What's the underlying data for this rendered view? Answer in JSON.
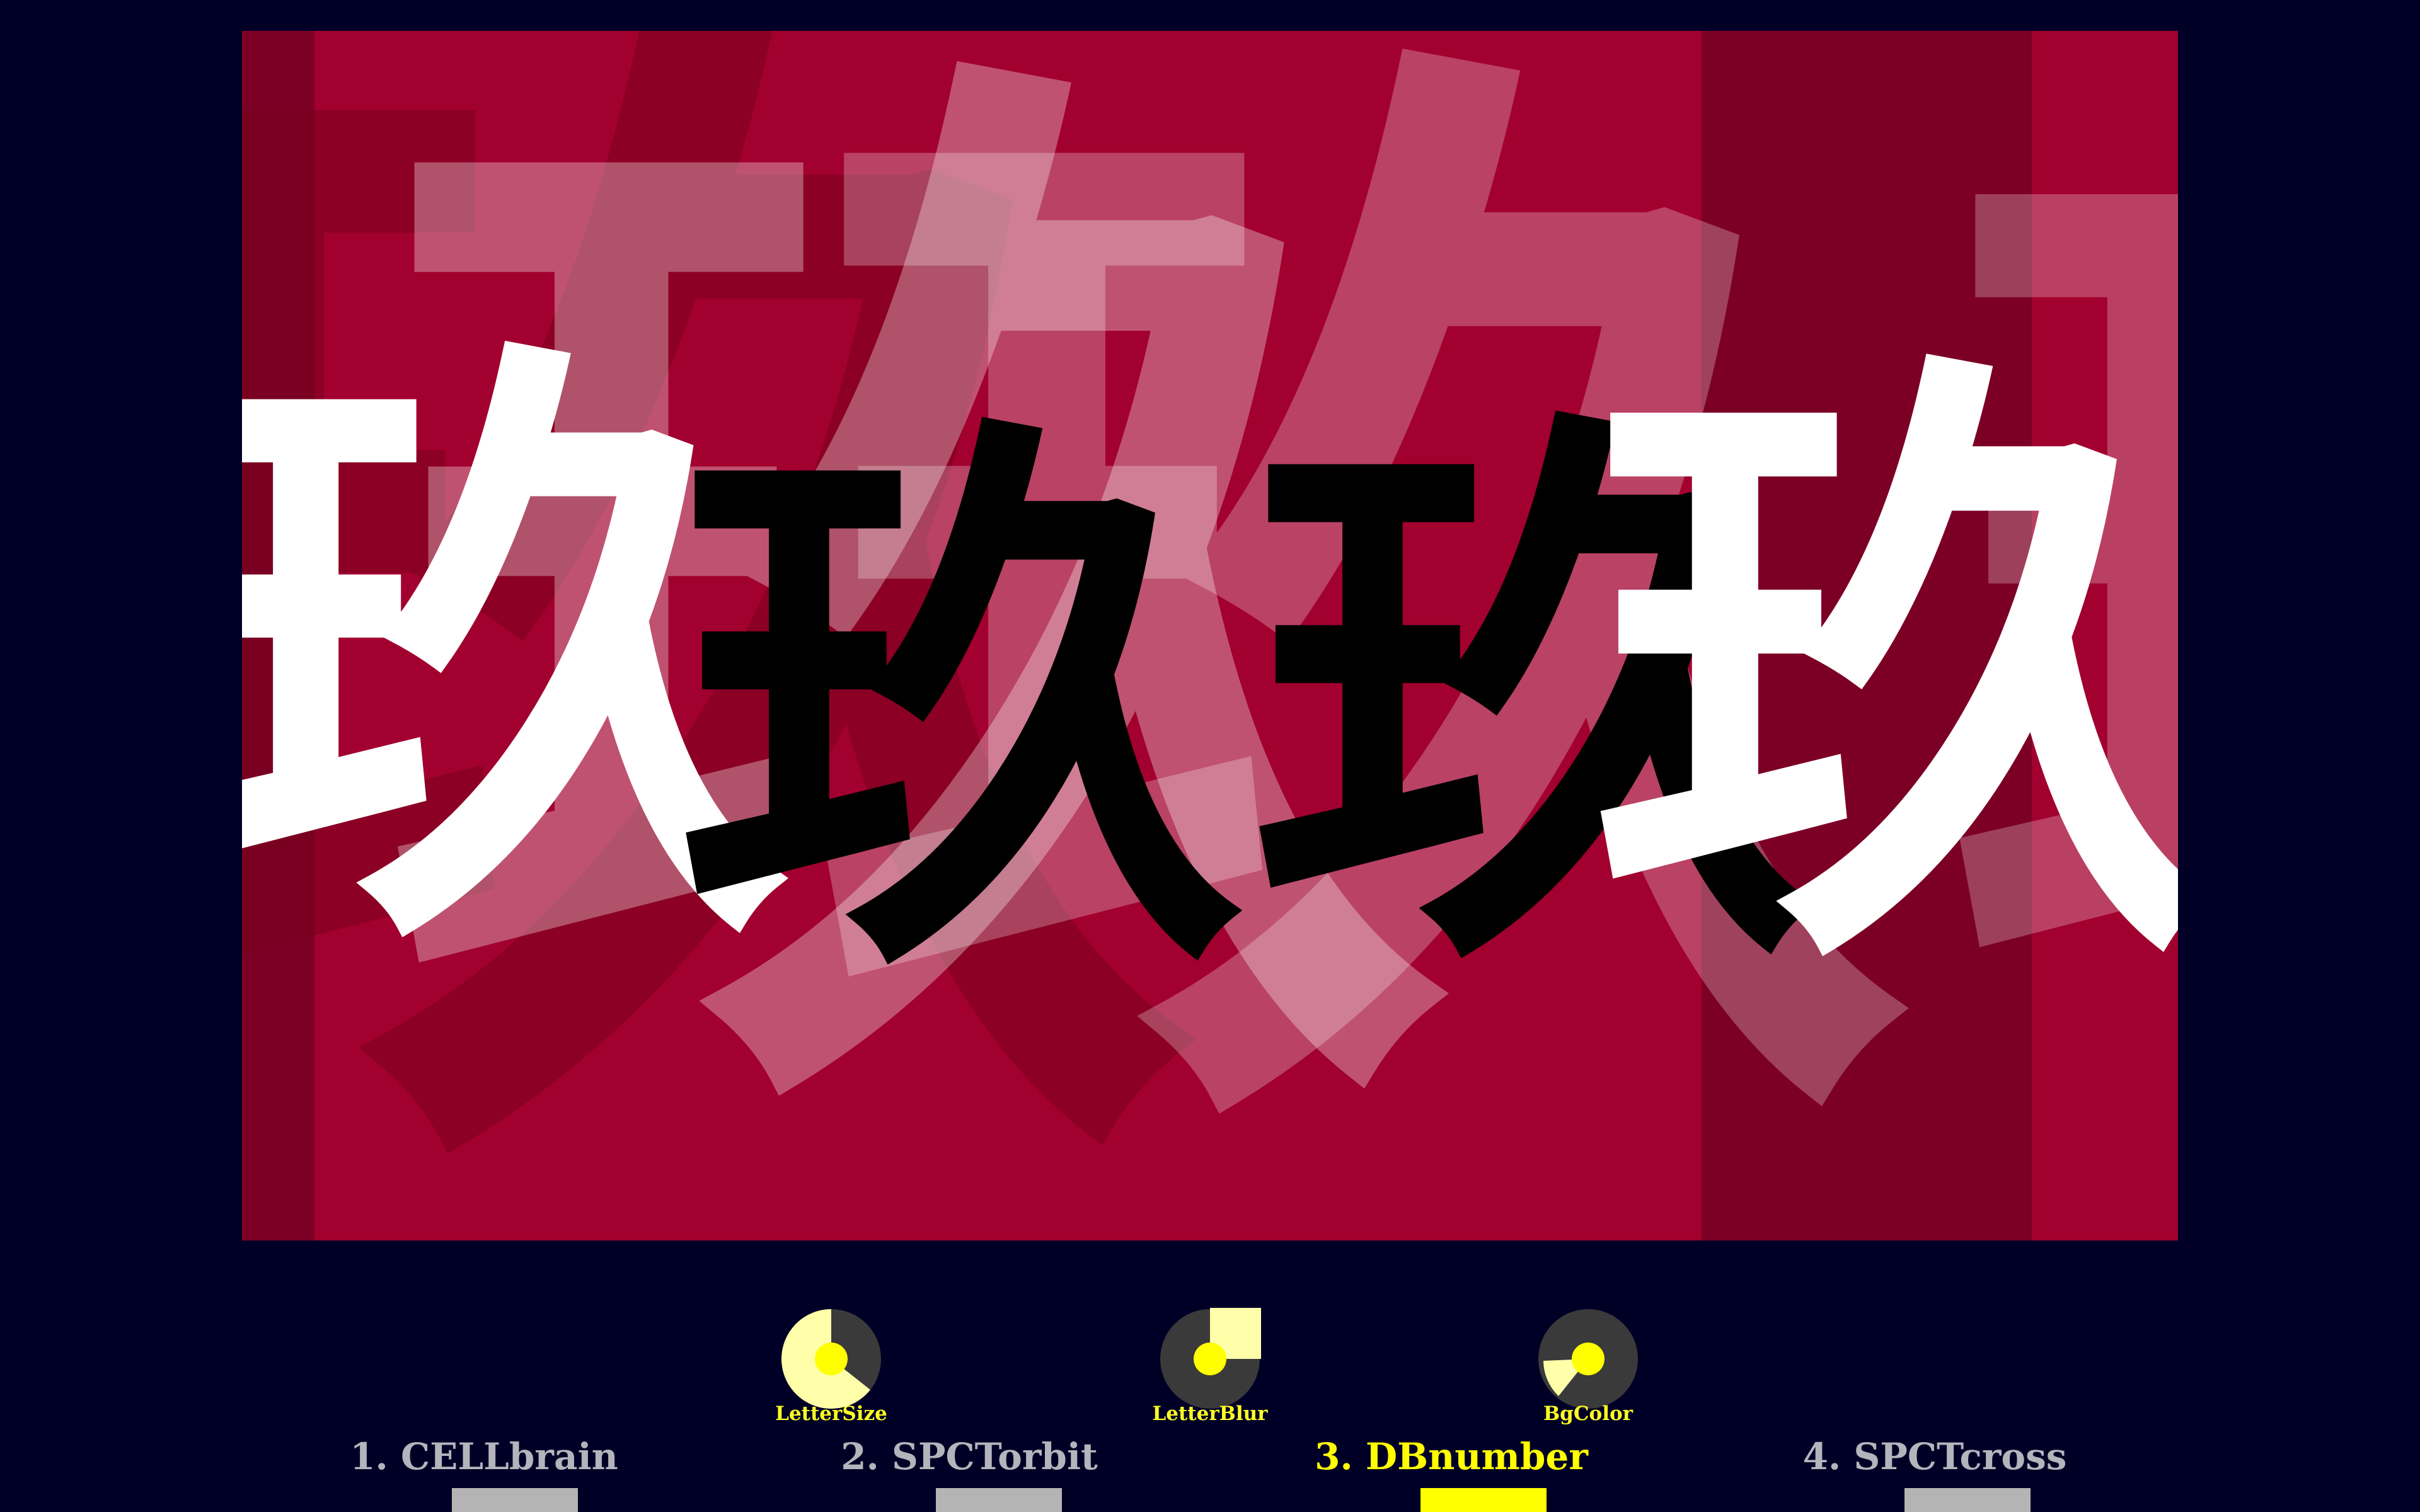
{
  "scene": {
    "glyph": "玖",
    "background_color": "#a2002e",
    "band_color": "#7c0026",
    "main_glyph_colors": [
      "#ffffff",
      "#000000",
      "#000000",
      "#ffffff"
    ]
  },
  "knobs": [
    {
      "label": "LetterSize",
      "level": 0.6
    },
    {
      "label": "LetterBlur",
      "level": 0.85
    },
    {
      "label": "BgColor",
      "level": 0.3
    }
  ],
  "tabs": [
    {
      "label": "1. CELLbrain",
      "active": false
    },
    {
      "label": "2. SPCTorbit",
      "active": false
    },
    {
      "label": "3. DBnumber",
      "active": true
    },
    {
      "label": "4. SPCTcross",
      "active": false
    }
  ],
  "colors": {
    "page_background": "#000027",
    "accent": "#ffff00",
    "inactive": "#b4b4bc"
  }
}
